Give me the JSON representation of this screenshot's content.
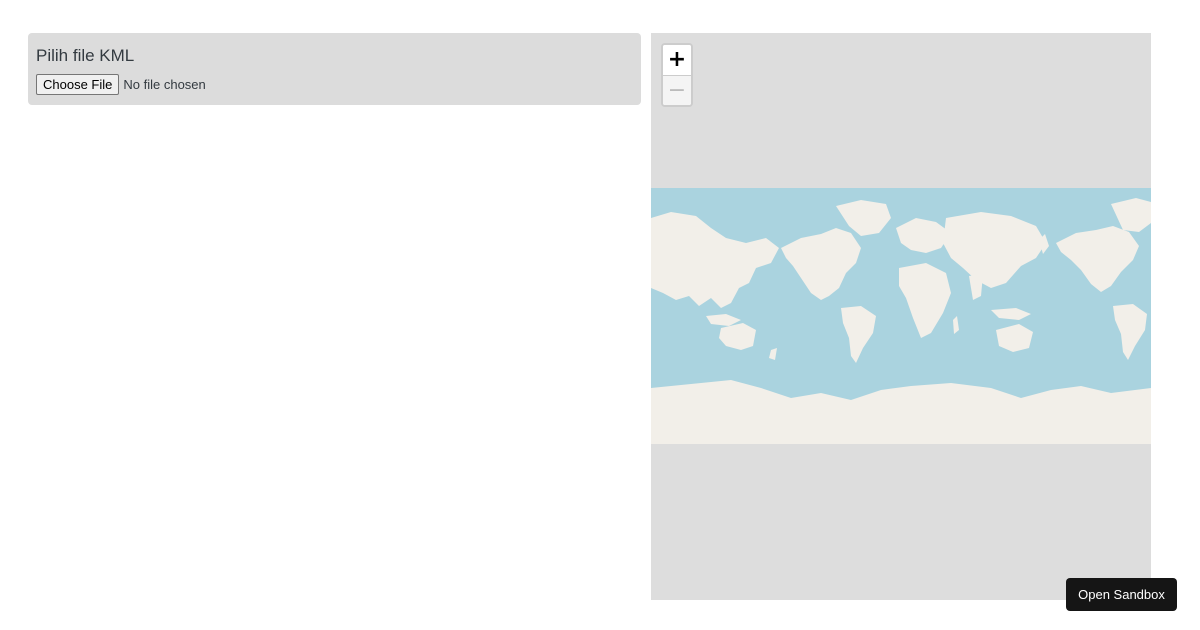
{
  "form": {
    "title": "Pilih file KML",
    "choose_label": "Choose File",
    "status": "No file chosen"
  },
  "map": {
    "zoom_in": "+",
    "zoom_out": "−",
    "ocean_color": "#aad3df",
    "land_color": "#f2efe9",
    "background_color": "#dddddd",
    "zoom_level": 0
  },
  "sandbox": {
    "label": "Open Sandbox"
  }
}
